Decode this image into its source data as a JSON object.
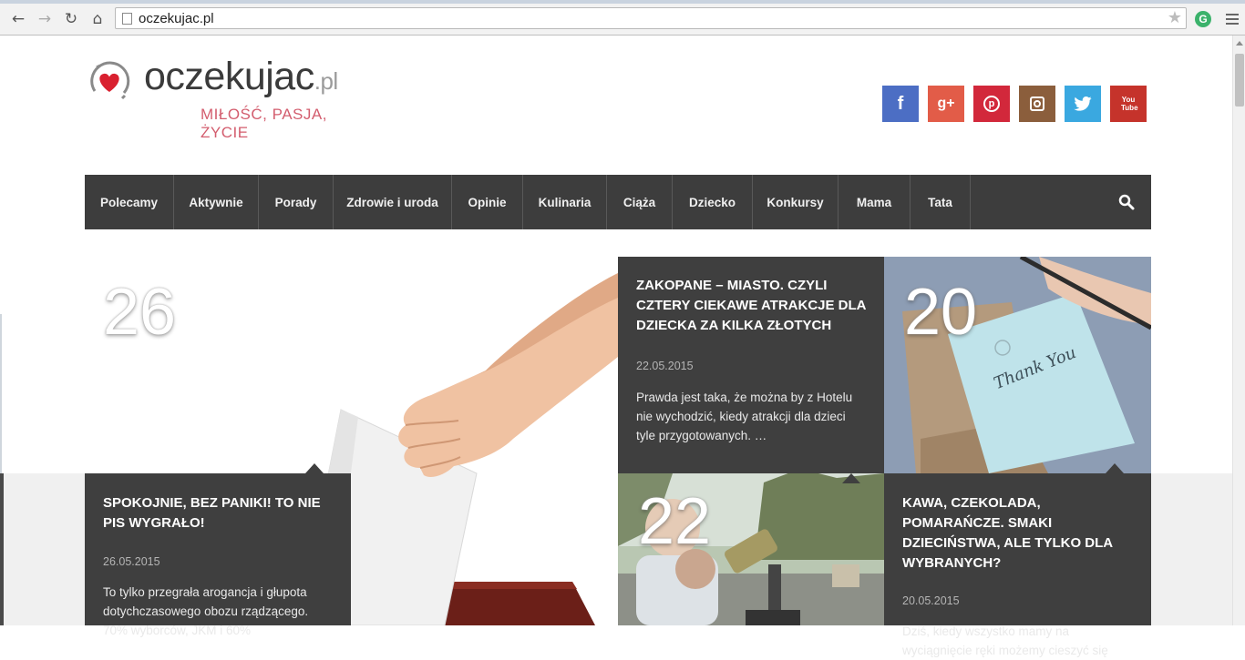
{
  "browser": {
    "url": "oczekujac.pl",
    "back_icon": "back-arrow-icon",
    "forward_icon": "forward-arrow-icon",
    "reload_icon": "reload-icon",
    "home_icon": "home-icon",
    "extension_letter": "G"
  },
  "site": {
    "logo_main": "oczekujac",
    "logo_tld": ".pl",
    "tagline": "MIŁOŚĆ, PASJA, ŻYCIE",
    "social": [
      {
        "name": "facebook",
        "glyph": "f",
        "color": "#4c6ec4"
      },
      {
        "name": "google-plus",
        "glyph": "g+",
        "color": "#e25c48"
      },
      {
        "name": "pinterest",
        "glyph": "p",
        "color": "#d2283b"
      },
      {
        "name": "instagram",
        "glyph": "",
        "color": "#8b5e3c"
      },
      {
        "name": "twitter",
        "glyph": "",
        "color": "#3aa8e0"
      },
      {
        "name": "youtube",
        "glyph": "You Tube",
        "color": "#c5332b"
      }
    ]
  },
  "nav": {
    "items": [
      "Polecamy",
      "Aktywnie",
      "Porady",
      "Zdrowie i uroda",
      "Opinie",
      "Kulinaria",
      "Ciąża",
      "Dziecko",
      "Konkursy",
      "Mama",
      "Tata"
    ]
  },
  "posts": {
    "main": {
      "day": "26",
      "title": "SPOKOJNIE, BEZ PANIKI! TO NIE PIS WYGRAŁO!",
      "date": "26.05.2015",
      "excerpt": "To tylko przegrała arogancja i głupota dotychczasowego obozu rządzącego. 70% wyborców, JKM i 60%"
    },
    "zakopane": {
      "title": "ZAKOPANE – MIASTO. CZYLI CZTERY CIEKAWE ATRAKCJE DLA DZIECKA ZA KILKA ZŁOTYCH",
      "date": "22.05.2015",
      "excerpt": "Prawda jest taka, że można by z Hotelu nie wychodzić, kiedy atrakcji dla dzieci tyle przygotowanych. …",
      "day": "22"
    },
    "kawa": {
      "day": "20",
      "title": "KAWA, CZEKOLADA, POMARAŃCZE. SMAKI DZIECIŃSTWA, ALE TYLKO DLA WYBRANYCH?",
      "date": "20.05.2015",
      "excerpt": "Dziś, kiedy wszystko mamy na wyciągnięcie ręki możemy cieszyć się"
    },
    "thankyou_text": "Thank You"
  },
  "colors": {
    "accent": "#d35d6e",
    "nav_bg": "#3d3d3d",
    "card_bg": "#3f3f3f"
  }
}
